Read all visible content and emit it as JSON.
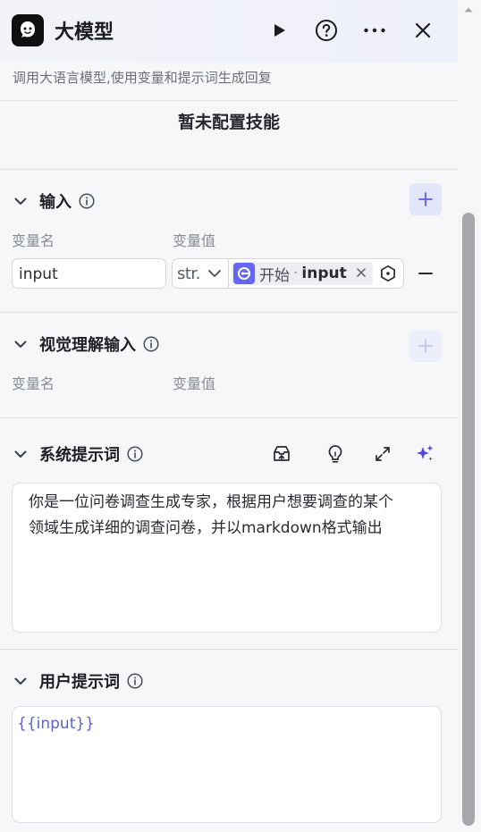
{
  "header": {
    "title": "大模型",
    "subtitle": "调用大语言模型,使用变量和提示词生成回复",
    "icons": [
      "robot-logo-icon",
      "play-icon",
      "help-icon",
      "more-icon",
      "close-icon"
    ]
  },
  "skills": {
    "empty_text": "暂未配置技能"
  },
  "input_section": {
    "title": "输入",
    "col_name": "变量名",
    "col_value": "变量值",
    "rows": [
      {
        "name": "input",
        "type": "str.",
        "ref_node": "开始",
        "ref_sep": "·",
        "ref_var": "input"
      }
    ]
  },
  "vision_section": {
    "title": "视觉理解输入",
    "col_name": "变量名",
    "col_value": "变量值"
  },
  "system_prompt": {
    "title": "系统提示词",
    "text": "你是一位问卷调查生成专家，根据用户想要调查的某个\n领域生成详细的调查问卷，并以markdown格式输出",
    "tools": [
      "prompt-library-icon",
      "lightbulb-icon",
      "expand-icon",
      "ai-sparkle-icon"
    ]
  },
  "user_prompt": {
    "title": "用户提示词",
    "text": "{{input}}"
  },
  "colors": {
    "accent": "#6466f1",
    "add_button_bg": "#e3e5fb",
    "sparkle": "#4f46e5",
    "template_var": "#5b63c9"
  }
}
